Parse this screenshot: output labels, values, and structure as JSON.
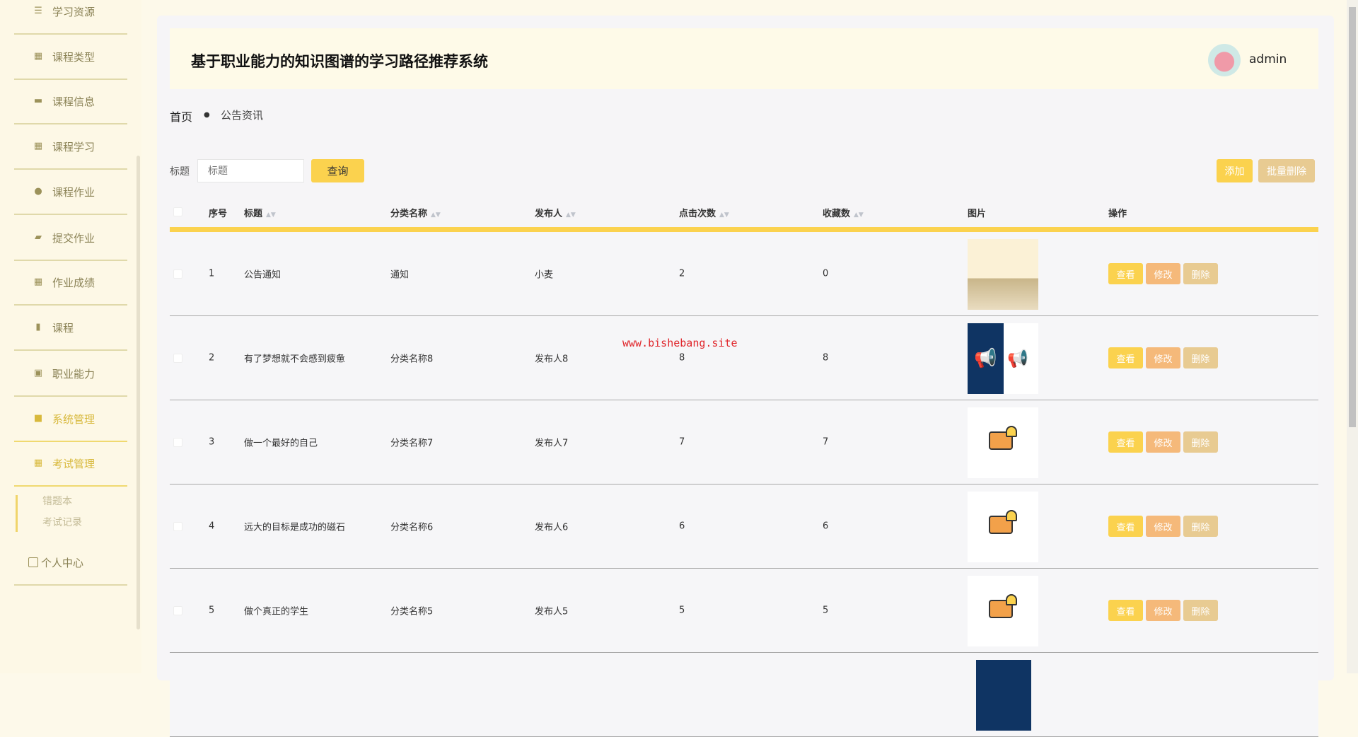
{
  "sidebar": {
    "items": [
      {
        "label": "学习资源",
        "icon": "sliders-icon"
      },
      {
        "label": "课程类型",
        "icon": "grid-icon"
      },
      {
        "label": "课程信息",
        "icon": "message-icon"
      },
      {
        "label": "课程学习",
        "icon": "grid-icon"
      },
      {
        "label": "课程作业",
        "icon": "pin-icon"
      },
      {
        "label": "提交作业",
        "icon": "wallet-icon"
      },
      {
        "label": "作业成绩",
        "icon": "grid-icon"
      },
      {
        "label": "课程",
        "icon": "bar-chart-icon"
      },
      {
        "label": "职业能力",
        "icon": "clipboard-icon"
      },
      {
        "label": "系统管理",
        "icon": "book-icon",
        "active": true
      },
      {
        "label": "考试管理",
        "icon": "grid-icon",
        "active": true
      }
    ],
    "submenu": [
      "错题本",
      "考试记录"
    ],
    "personal": "个人中心"
  },
  "header": {
    "title": "基于职业能力的知识图谱的学习路径推荐系统",
    "user": "admin"
  },
  "breadcrumb": {
    "home": "首页",
    "current": "公告资讯"
  },
  "search": {
    "label": "标题",
    "placeholder": "标题",
    "button": "查询"
  },
  "toolbar": {
    "add": "添加",
    "batch_delete": "批量删除"
  },
  "table": {
    "columns": [
      "序号",
      "标题",
      "分类名称",
      "发布人",
      "点击次数",
      "收藏数",
      "图片",
      "操作"
    ],
    "actions": [
      "查看",
      "修改",
      "删除"
    ],
    "rows": [
      {
        "no": "1",
        "title": "公告通知",
        "category": "通知",
        "publisher": "小麦",
        "clicks": "2",
        "favorites": "0",
        "image": "book"
      },
      {
        "no": "2",
        "title": "有了梦想就不会感到疲惫",
        "category": "分类名称8",
        "publisher": "发布人8",
        "clicks": "8",
        "favorites": "8",
        "image": "megaphone"
      },
      {
        "no": "3",
        "title": "做一个最好的自己",
        "category": "分类名称7",
        "publisher": "发布人7",
        "clicks": "7",
        "favorites": "7",
        "image": "notice"
      },
      {
        "no": "4",
        "title": "远大的目标是成功的磁石",
        "category": "分类名称6",
        "publisher": "发布人6",
        "clicks": "6",
        "favorites": "6",
        "image": "notice"
      },
      {
        "no": "5",
        "title": "做个真正的学生",
        "category": "分类名称5",
        "publisher": "发布人5",
        "clicks": "5",
        "favorites": "5",
        "image": "notice"
      }
    ]
  },
  "watermark": "www.bishebang.site",
  "colors": {
    "accent": "#fbd24e",
    "view": "#fbd24e",
    "edit": "#f5b97a",
    "delete": "#e8cb92"
  }
}
